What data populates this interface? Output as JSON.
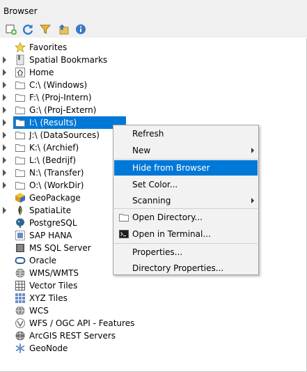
{
  "panel": {
    "title": "Browser"
  },
  "toolbar": [
    {
      "name": "add-selected-layers-button",
      "icon": "add-layer-icon"
    },
    {
      "name": "refresh-button",
      "icon": "refresh-icon"
    },
    {
      "name": "filter-button",
      "icon": "filter-icon"
    },
    {
      "name": "collapse-all-button",
      "icon": "collapse-icon"
    },
    {
      "name": "properties-button",
      "icon": "info-icon"
    }
  ],
  "tree": {
    "items": [
      {
        "label": "Favorites",
        "icon": "star-icon",
        "expandable": false
      },
      {
        "label": "Spatial Bookmarks",
        "icon": "bookmark-icon",
        "expandable": true
      },
      {
        "label": "Home",
        "icon": "home-icon",
        "expandable": true
      },
      {
        "label": "C:\\ (Windows)",
        "icon": "folder-icon",
        "expandable": true
      },
      {
        "label": "F:\\ (Proj-Intern)",
        "icon": "folder-icon",
        "expandable": true
      },
      {
        "label": "G:\\ (Proj-Extern)",
        "icon": "folder-icon",
        "expandable": true
      },
      {
        "label": "I:\\ (Results)",
        "icon": "folder-icon",
        "expandable": true,
        "selected": true
      },
      {
        "label": "J:\\ (DataSources)",
        "icon": "folder-icon",
        "expandable": true
      },
      {
        "label": "K:\\ (Archief)",
        "icon": "folder-icon",
        "expandable": true
      },
      {
        "label": "L:\\ (Bedrijf)",
        "icon": "folder-icon",
        "expandable": true
      },
      {
        "label": "N:\\ (Transfer)",
        "icon": "folder-icon",
        "expandable": true
      },
      {
        "label": "O:\\ (WorkDir)",
        "icon": "folder-icon",
        "expandable": true
      },
      {
        "label": "GeoPackage",
        "icon": "geopackage-icon",
        "expandable": false
      },
      {
        "label": "SpatiaLite",
        "icon": "spatialite-icon",
        "expandable": true
      },
      {
        "label": "PostgreSQL",
        "icon": "postgresql-icon",
        "expandable": false
      },
      {
        "label": "SAP HANA",
        "icon": "sap-hana-icon",
        "expandable": false
      },
      {
        "label": "MS SQL Server",
        "icon": "mssql-icon",
        "expandable": false
      },
      {
        "label": "Oracle",
        "icon": "oracle-icon",
        "expandable": false
      },
      {
        "label": "WMS/WMTS",
        "icon": "wms-icon",
        "expandable": false
      },
      {
        "label": "Vector Tiles",
        "icon": "vector-tiles-icon",
        "expandable": false
      },
      {
        "label": "XYZ Tiles",
        "icon": "xyz-tiles-icon",
        "expandable": false
      },
      {
        "label": "WCS",
        "icon": "wcs-icon",
        "expandable": false
      },
      {
        "label": "WFS / OGC API - Features",
        "icon": "wfs-icon",
        "expandable": false
      },
      {
        "label": "ArcGIS REST Servers",
        "icon": "arcgis-icon",
        "expandable": false
      },
      {
        "label": "GeoNode",
        "icon": "geonode-icon",
        "expandable": false
      }
    ]
  },
  "context_menu": {
    "items": [
      {
        "label": "Refresh"
      },
      {
        "label": "New",
        "submenu": true
      },
      {
        "label": "Hide from Browser",
        "active": true
      },
      {
        "label": "Set Color..."
      },
      {
        "label": "Scanning",
        "submenu": true
      },
      {
        "label": "Open Directory...",
        "icon": "folder-icon"
      },
      {
        "label": "Open in Terminal...",
        "icon": "terminal-icon"
      },
      {
        "label": "Properties..."
      },
      {
        "label": "Directory Properties..."
      }
    ]
  },
  "colors": {
    "selection": "#0078d7",
    "panel_bg": "#f0f0f0",
    "folder": "#e8c35a"
  }
}
